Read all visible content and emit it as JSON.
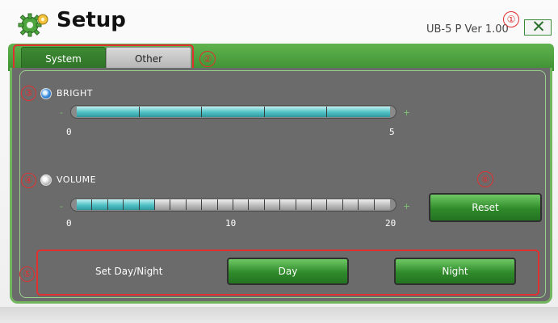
{
  "app": {
    "title": "Setup",
    "version": "UB-5 P Ver 1.00",
    "close_symbol": "✕",
    "icon": "gear-icon"
  },
  "tabs": [
    {
      "label": "System",
      "selected": true
    },
    {
      "label": "Other",
      "selected": false
    }
  ],
  "bright": {
    "label": "BRIGHT",
    "selected": true,
    "min_label": "0",
    "max_label": "5",
    "value": 5,
    "max": 5,
    "minus": "-",
    "plus": "+"
  },
  "volume": {
    "label": "VOLUME",
    "selected": false,
    "min_label": "0",
    "mid_label": "10",
    "max_label": "20",
    "value": 5,
    "max": 20,
    "minus": "-",
    "plus": "+"
  },
  "reset_label": "Reset",
  "day_night": {
    "label": "Set Day/Night",
    "day_label": "Day",
    "night_label": "Night"
  },
  "callouts": [
    "①",
    "②",
    "③",
    "④",
    "⑤",
    "⑥"
  ],
  "colors": {
    "accent_green": "#3f8f34",
    "panel_gray": "#6b6b6b",
    "slider_on": "#4fc0c4",
    "callout_red": "#e03030"
  }
}
